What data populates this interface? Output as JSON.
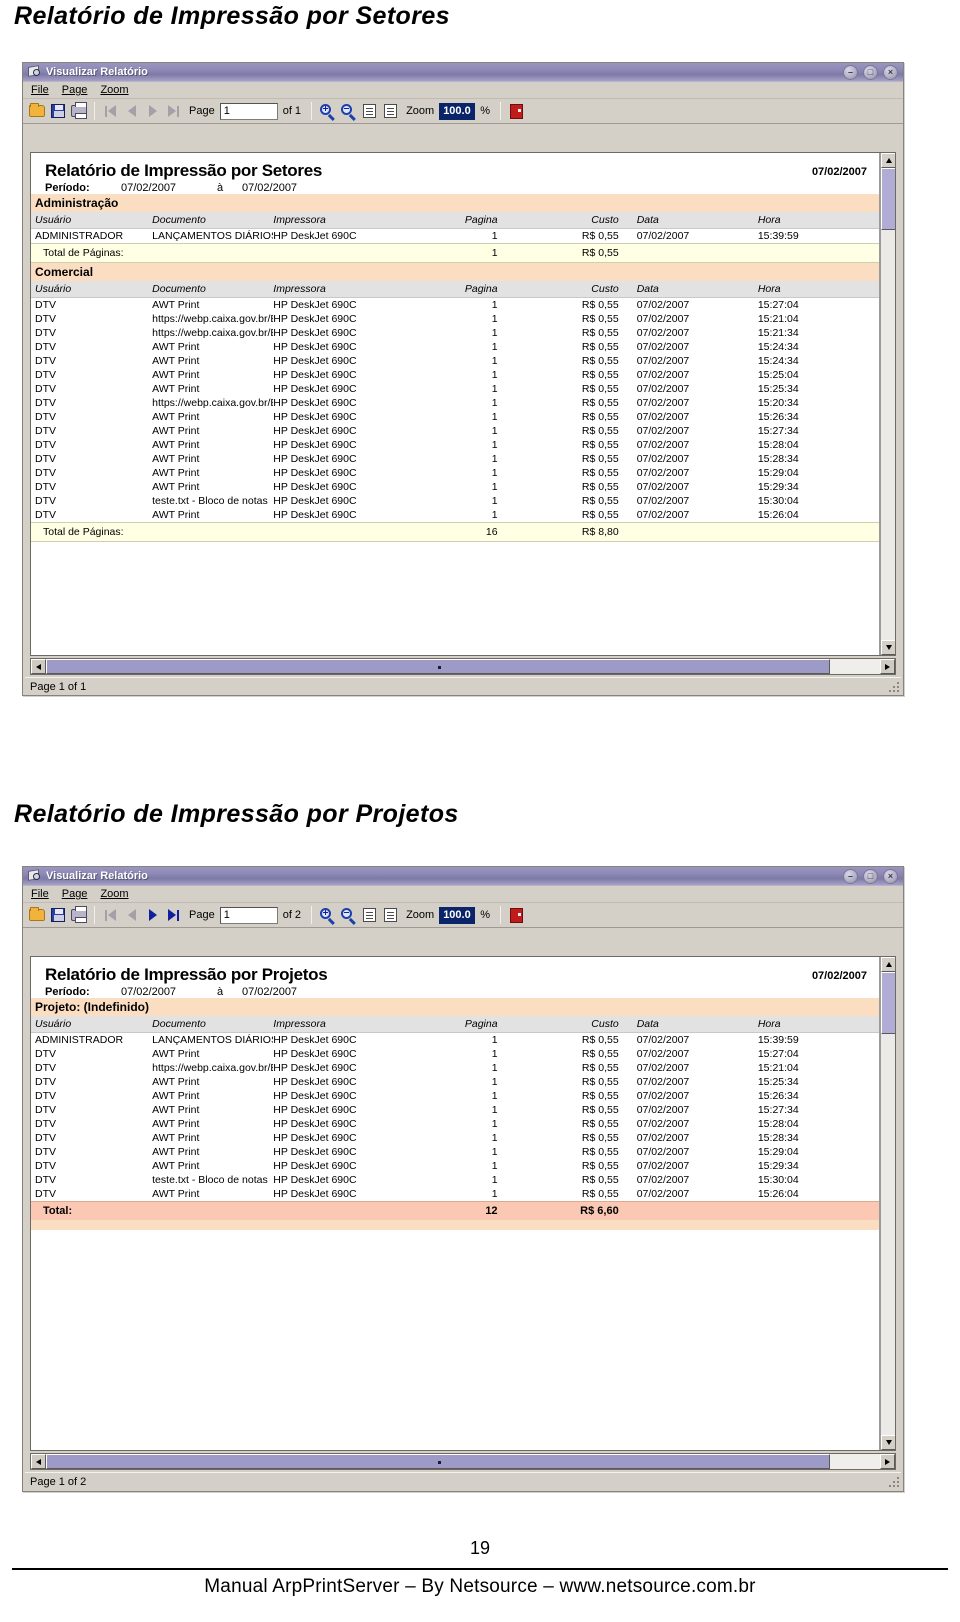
{
  "headings": {
    "report1": "Relatório de Impressão por Setores",
    "report2": "Relatório de Impressão por Projetos"
  },
  "footer": {
    "page_number": "19",
    "text": "Manual ArpPrintServer – By Netsource – www.netsource.com.br"
  },
  "window_common": {
    "title": "Visualizar Relatório",
    "icon": "report-viewer-icon",
    "buttons": {
      "minimize": "minimize-button",
      "maximize": "maximize-button",
      "close": "close-button",
      "minimize_glyph": "–",
      "maximize_glyph": "□",
      "close_glyph": "×"
    },
    "menu": [
      {
        "label": "File"
      },
      {
        "label": "Page"
      },
      {
        "label": "Zoom"
      }
    ],
    "toolbar": {
      "open_icon": "open-folder-icon",
      "save_icon": "save-disk-icon",
      "print_icon": "printer-icon",
      "first_icon": "first-page-icon",
      "prev_icon": "previous-page-icon",
      "next_icon": "next-page-icon",
      "last_icon": "last-page-icon",
      "page_label": "Page",
      "zoom_in_icon": "zoom-in-icon",
      "zoom_out_icon": "zoom-out-icon",
      "fit_width_icon": "fit-width-icon",
      "fit_page_icon": "fit-page-icon",
      "zoom_label": "Zoom",
      "percent_label": "%",
      "exit_icon": "exit-icon"
    },
    "table_headers": {
      "usuario": "Usuário",
      "documento": "Documento",
      "impressora": "Impressora",
      "pagina": "Pagina",
      "custo": "Custo",
      "data": "Data",
      "hora": "Hora"
    },
    "period_label": "Período:",
    "period_sep": "à"
  },
  "window1": {
    "toolbar": {
      "page_value": "1",
      "page_of": "of 1",
      "zoom_value": "100.0",
      "nav_first_enabled": false,
      "nav_prev_enabled": false,
      "nav_next_enabled": false,
      "nav_last_enabled": false
    },
    "status": "Page 1 of 1",
    "report": {
      "title": "Relatório de Impressão por Setores",
      "date": "07/02/2007",
      "period_from": "07/02/2007",
      "period_to": "07/02/2007",
      "sections": [
        {
          "name": "Administração",
          "rows": [
            {
              "usuario": "ADMINISTRADOR",
              "documento": "LANÇAMENTOS  DIÁRIOS  DISTRIVISA.",
              "impressora": "HP DeskJet  690C",
              "pagina": "1",
              "custo": "R$ 0,55",
              "data": "07/02/2007",
              "hora": "15:39:59"
            }
          ],
          "total": {
            "label": "Total de Páginas:",
            "pagina": "1",
            "custo": "R$ 0,55"
          }
        },
        {
          "name": "Comercial",
          "rows": [
            {
              "usuario": "DTV",
              "documento": "AWT Print",
              "impressora": "HP DeskJet  690C",
              "pagina": "1",
              "custo": "R$ 0,55",
              "data": "07/02/2007",
              "hora": "15:27:04"
            },
            {
              "usuario": "DTV",
              "documento": "https://webp.caixa.gov.br/Empresa/Crf/Cr",
              "impressora": "HP DeskJet  690C",
              "pagina": "1",
              "custo": "R$ 0,55",
              "data": "07/02/2007",
              "hora": "15:21:04"
            },
            {
              "usuario": "DTV",
              "documento": "https://webp.caixa.gov.br/Empresa/Crf/Cr",
              "impressora": "HP DeskJet  690C",
              "pagina": "1",
              "custo": "R$ 0,55",
              "data": "07/02/2007",
              "hora": "15:21:34"
            },
            {
              "usuario": "DTV",
              "documento": "AWT Print",
              "impressora": "HP DeskJet  690C",
              "pagina": "1",
              "custo": "R$ 0,55",
              "data": "07/02/2007",
              "hora": "15:24:34"
            },
            {
              "usuario": "DTV",
              "documento": "AWT Print",
              "impressora": "HP DeskJet  690C",
              "pagina": "1",
              "custo": "R$ 0,55",
              "data": "07/02/2007",
              "hora": "15:24:34"
            },
            {
              "usuario": "DTV",
              "documento": "AWT Print",
              "impressora": "HP DeskJet  690C",
              "pagina": "1",
              "custo": "R$ 0,55",
              "data": "07/02/2007",
              "hora": "15:25:04"
            },
            {
              "usuario": "DTV",
              "documento": "AWT Print",
              "impressora": "HP DeskJet  690C",
              "pagina": "1",
              "custo": "R$ 0,55",
              "data": "07/02/2007",
              "hora": "15:25:34"
            },
            {
              "usuario": "DTV",
              "documento": "https://webp.caixa.gov.br/Empresa/Crf/Cr",
              "impressora": "HP DeskJet  690C",
              "pagina": "1",
              "custo": "R$ 0,55",
              "data": "07/02/2007",
              "hora": "15:20:34"
            },
            {
              "usuario": "DTV",
              "documento": "AWT Print",
              "impressora": "HP DeskJet  690C",
              "pagina": "1",
              "custo": "R$ 0,55",
              "data": "07/02/2007",
              "hora": "15:26:34"
            },
            {
              "usuario": "DTV",
              "documento": "AWT Print",
              "impressora": "HP DeskJet  690C",
              "pagina": "1",
              "custo": "R$ 0,55",
              "data": "07/02/2007",
              "hora": "15:27:34"
            },
            {
              "usuario": "DTV",
              "documento": "AWT Print",
              "impressora": "HP DeskJet  690C",
              "pagina": "1",
              "custo": "R$ 0,55",
              "data": "07/02/2007",
              "hora": "15:28:04"
            },
            {
              "usuario": "DTV",
              "documento": "AWT Print",
              "impressora": "HP DeskJet  690C",
              "pagina": "1",
              "custo": "R$ 0,55",
              "data": "07/02/2007",
              "hora": "15:28:34"
            },
            {
              "usuario": "DTV",
              "documento": "AWT Print",
              "impressora": "HP DeskJet  690C",
              "pagina": "1",
              "custo": "R$ 0,55",
              "data": "07/02/2007",
              "hora": "15:29:04"
            },
            {
              "usuario": "DTV",
              "documento": "AWT Print",
              "impressora": "HP DeskJet  690C",
              "pagina": "1",
              "custo": "R$ 0,55",
              "data": "07/02/2007",
              "hora": "15:29:34"
            },
            {
              "usuario": "DTV",
              "documento": "teste.txt - Bloco de notas",
              "impressora": "HP DeskJet  690C",
              "pagina": "1",
              "custo": "R$ 0,55",
              "data": "07/02/2007",
              "hora": "15:30:04"
            },
            {
              "usuario": "DTV",
              "documento": "AWT Print",
              "impressora": "HP DeskJet  690C",
              "pagina": "1",
              "custo": "R$ 0,55",
              "data": "07/02/2007",
              "hora": "15:26:04"
            }
          ],
          "total": {
            "label": "Total de Páginas:",
            "pagina": "16",
            "custo": "R$ 8,80"
          }
        }
      ]
    }
  },
  "window2": {
    "toolbar": {
      "page_value": "1",
      "page_of": "of 2",
      "zoom_value": "100.0",
      "nav_first_enabled": false,
      "nav_prev_enabled": false,
      "nav_next_enabled": true,
      "nav_last_enabled": true
    },
    "status": "Page 1 of 2",
    "report": {
      "title": "Relatório de Impressão por Projetos",
      "date": "07/02/2007",
      "period_from": "07/02/2007",
      "period_to": "07/02/2007",
      "sections": [
        {
          "name": "Projeto:  (Indefinido)",
          "rows": [
            {
              "usuario": "ADMINISTRADOR",
              "documento": "LANÇAMENTOS  DIÁRIOS  DISTRIVISA.",
              "impressora": "HP DeskJet  690C",
              "pagina": "1",
              "custo": "R$ 0,55",
              "data": "07/02/2007",
              "hora": "15:39:59"
            },
            {
              "usuario": "DTV",
              "documento": "AWT Print",
              "impressora": "HP DeskJet  690C",
              "pagina": "1",
              "custo": "R$ 0,55",
              "data": "07/02/2007",
              "hora": "15:27:04"
            },
            {
              "usuario": "DTV",
              "documento": "https://webp.caixa.gov.br/Empresa/Crf/Cr",
              "impressora": "HP DeskJet  690C",
              "pagina": "1",
              "custo": "R$ 0,55",
              "data": "07/02/2007",
              "hora": "15:21:04"
            },
            {
              "usuario": "DTV",
              "documento": "AWT Print",
              "impressora": "HP DeskJet  690C",
              "pagina": "1",
              "custo": "R$ 0,55",
              "data": "07/02/2007",
              "hora": "15:25:34"
            },
            {
              "usuario": "DTV",
              "documento": "AWT Print",
              "impressora": "HP DeskJet  690C",
              "pagina": "1",
              "custo": "R$ 0,55",
              "data": "07/02/2007",
              "hora": "15:26:34"
            },
            {
              "usuario": "DTV",
              "documento": "AWT Print",
              "impressora": "HP DeskJet  690C",
              "pagina": "1",
              "custo": "R$ 0,55",
              "data": "07/02/2007",
              "hora": "15:27:34"
            },
            {
              "usuario": "DTV",
              "documento": "AWT Print",
              "impressora": "HP DeskJet  690C",
              "pagina": "1",
              "custo": "R$ 0,55",
              "data": "07/02/2007",
              "hora": "15:28:04"
            },
            {
              "usuario": "DTV",
              "documento": "AWT Print",
              "impressora": "HP DeskJet  690C",
              "pagina": "1",
              "custo": "R$ 0,55",
              "data": "07/02/2007",
              "hora": "15:28:34"
            },
            {
              "usuario": "DTV",
              "documento": "AWT Print",
              "impressora": "HP DeskJet  690C",
              "pagina": "1",
              "custo": "R$ 0,55",
              "data": "07/02/2007",
              "hora": "15:29:04"
            },
            {
              "usuario": "DTV",
              "documento": "AWT Print",
              "impressora": "HP DeskJet  690C",
              "pagina": "1",
              "custo": "R$ 0,55",
              "data": "07/02/2007",
              "hora": "15:29:34"
            },
            {
              "usuario": "DTV",
              "documento": "teste.txt - Bloco de notas",
              "impressora": "HP DeskJet  690C",
              "pagina": "1",
              "custo": "R$ 0,55",
              "data": "07/02/2007",
              "hora": "15:30:04"
            },
            {
              "usuario": "DTV",
              "documento": "AWT Print",
              "impressora": "HP DeskJet  690C",
              "pagina": "1",
              "custo": "R$ 0,55",
              "data": "07/02/2007",
              "hora": "15:26:04"
            }
          ],
          "total": {
            "label": "Total:",
            "pagina": "12",
            "custo": "R$ 6,60"
          }
        }
      ]
    }
  },
  "colors": {
    "titlebar": "#8d89b6",
    "group_header": "#fbddc2",
    "column_header": "#e2e2e2",
    "total_row": "#ffffe4",
    "total_pink": "#fbc9b3",
    "window_face": "#d4d0c8",
    "scroll_thumb": "#9e9ac8"
  }
}
